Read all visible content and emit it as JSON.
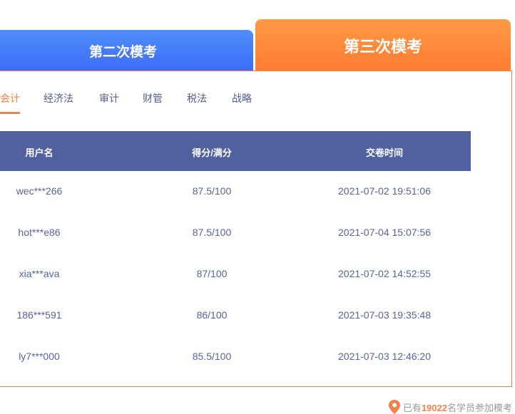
{
  "tabs": [
    {
      "label": "第二次模考",
      "active": false
    },
    {
      "label": "第三次模考",
      "active": true
    }
  ],
  "subjects": [
    {
      "label": "会计",
      "active": true
    },
    {
      "label": "经济法"
    },
    {
      "label": "审计"
    },
    {
      "label": "财管"
    },
    {
      "label": "税法"
    },
    {
      "label": "战略"
    }
  ],
  "table": {
    "headers": [
      "用户名",
      "得分/满分",
      "交卷时间"
    ],
    "rows": [
      [
        "wec***266",
        "87.5/100",
        "2021-07-02 19:51:06"
      ],
      [
        "hot***e86",
        "87.5/100",
        "2021-07-04 15:07:56"
      ],
      [
        "xia***ava",
        "87/100",
        "2021-07-02 14:52:55"
      ],
      [
        "186***591",
        "86/100",
        "2021-07-03 19:35:48"
      ],
      [
        "ly7***000",
        "85.5/100",
        "2021-07-03 12:46:20"
      ]
    ]
  },
  "footer": {
    "prefix": "已有",
    "count": "19022",
    "suffix": "名学员参加模考",
    "icon": "location-pin-icon"
  },
  "colors": {
    "accent": "#f3814a",
    "header": "#5161a0",
    "blue_tab": "#4f8efc"
  }
}
